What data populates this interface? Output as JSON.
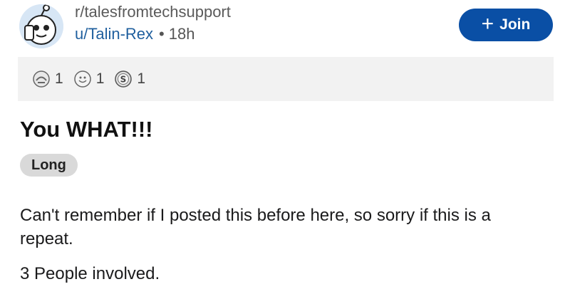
{
  "post": {
    "subreddit": "r/talesfromtechsupport",
    "author": "u/Talin-Rex",
    "separator": "•",
    "age": "18h",
    "join_label": "Join",
    "join_icon": "plus-icon",
    "awards": [
      {
        "icon": "award-hug-icon",
        "count": "1"
      },
      {
        "icon": "award-smile-icon",
        "count": "1"
      },
      {
        "icon": "award-silver-icon",
        "count": "1"
      }
    ],
    "title": "You WHAT!!!",
    "flair": "Long",
    "paragraphs": [
      "Can't remember if I posted this before here, so sorry if this is a repeat.",
      "3 People involved."
    ]
  },
  "colors": {
    "join_bg": "#0a4fa5",
    "author": "#1f5f9e",
    "awards_bg": "#f2f2f2",
    "flair_bg": "#d9d9d9"
  }
}
